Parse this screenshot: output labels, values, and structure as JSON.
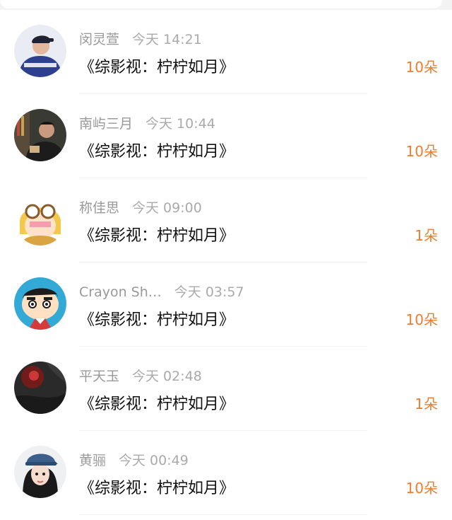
{
  "gift_list": {
    "items": [
      {
        "name": "闵灵萱",
        "time": "今天 14:21",
        "title": "《综影视：柠柠如月》",
        "count": "10朵",
        "avatar_icon": "person-jacket-avatar"
      },
      {
        "name": "南屿三月",
        "time": "今天 10:44",
        "title": "《综影视：柠柠如月》",
        "count": "10朵",
        "avatar_icon": "person-dark-photo-avatar"
      },
      {
        "name": "称佳思",
        "time": "今天 09:00",
        "title": "《综影视：柠柠如月》",
        "count": "1朵",
        "avatar_icon": "cartoon-goggles-avatar"
      },
      {
        "name": "Crayon Sh…",
        "time": "今天 03:57",
        "title": "《综影视：柠柠如月》",
        "count": "10朵",
        "avatar_icon": "crayon-shin-chan-avatar"
      },
      {
        "name": "平天玉",
        "time": "今天 02:48",
        "title": "《综影视：柠柠如月》",
        "count": "1朵",
        "avatar_icon": "dark-photo-avatar"
      },
      {
        "name": "黄骊",
        "time": "今天 00:49",
        "title": "《综影视：柠柠如月》",
        "count": "10朵",
        "avatar_icon": "girl-cap-avatar"
      }
    ]
  },
  "colors": {
    "count_orange": "#ec7d2e",
    "meta_gray": "#999999",
    "title_black": "#111111"
  }
}
